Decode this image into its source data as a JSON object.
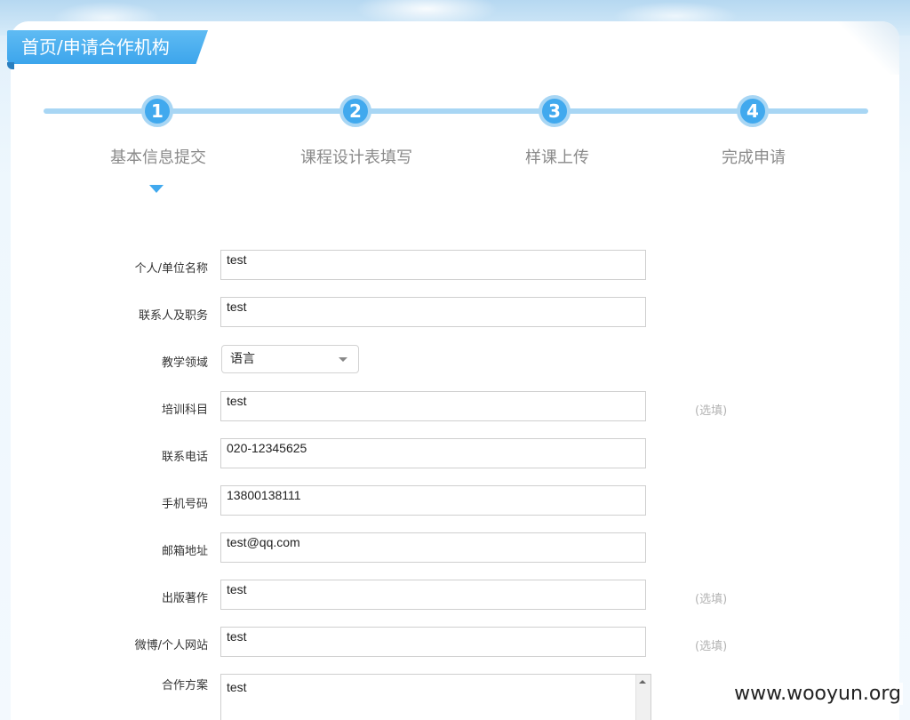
{
  "breadcrumb": "首页/申请合作机构",
  "steps": [
    {
      "number": "1",
      "label": "基本信息提交"
    },
    {
      "number": "2",
      "label": "课程设计表填写"
    },
    {
      "number": "3",
      "label": "样课上传"
    },
    {
      "number": "4",
      "label": "完成申请"
    }
  ],
  "form": {
    "name": {
      "label": "个人/单位名称",
      "value": "test"
    },
    "contact": {
      "label": "联系人及职务",
      "value": "test"
    },
    "field": {
      "label": "教学领域",
      "selected": "语言"
    },
    "subject": {
      "label": "培训科目",
      "value": "test",
      "note": "(选填)"
    },
    "phone": {
      "label": "联系电话",
      "value": "020-12345625"
    },
    "mobile": {
      "label": "手机号码",
      "value": "13800138111"
    },
    "email": {
      "label": "邮箱地址",
      "value": "test@qq.com"
    },
    "publications": {
      "label": "出版著作",
      "value": "test",
      "note": "(选填)"
    },
    "website": {
      "label": "微博/个人网站",
      "value": "test",
      "note": "(选填)"
    },
    "plan": {
      "label": "合作方案",
      "value": "test"
    }
  },
  "watermark": "www.wooyun.org"
}
